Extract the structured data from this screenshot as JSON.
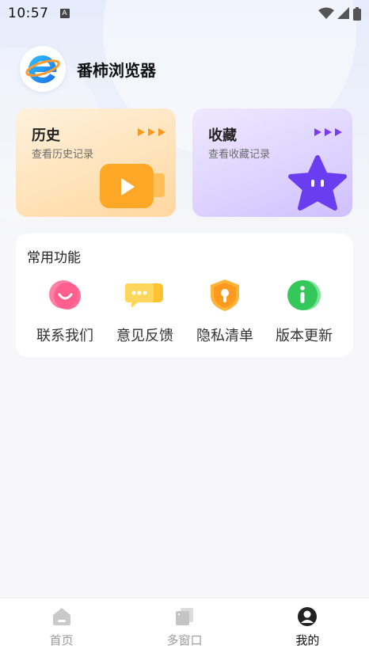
{
  "status_bar": {
    "time": "10:57",
    "notification_icon": "A",
    "icons": [
      "wifi-icon",
      "signal-icon",
      "battery-icon"
    ]
  },
  "app": {
    "title": "番柿浏览器",
    "logo_icon": "browser-e-logo"
  },
  "cards": {
    "history": {
      "title": "历史",
      "subtitle": "查看历史记录",
      "icon": "video-camera-icon",
      "accent": "#f5a623"
    },
    "favorites": {
      "title": "收藏",
      "subtitle": "查看收藏记录",
      "icon": "star-icon",
      "accent": "#7b4dff"
    }
  },
  "functions": {
    "title": "常用功能",
    "items": [
      {
        "label": "联系我们",
        "icon": "smile-chat-icon",
        "color": "#ff6f9a"
      },
      {
        "label": "意见反馈",
        "icon": "feedback-chat-icon",
        "color": "#ffb21e"
      },
      {
        "label": "隐私清单",
        "icon": "privacy-shield-icon",
        "color": "#ff9a1e"
      },
      {
        "label": "版本更新",
        "icon": "info-icon",
        "color": "#34c759"
      }
    ]
  },
  "bottom_nav": {
    "items": [
      {
        "label": "首页",
        "icon": "home-icon",
        "active": false
      },
      {
        "label": "多窗口",
        "icon": "windows-icon",
        "active": false
      },
      {
        "label": "我的",
        "icon": "profile-icon",
        "active": true
      }
    ]
  }
}
